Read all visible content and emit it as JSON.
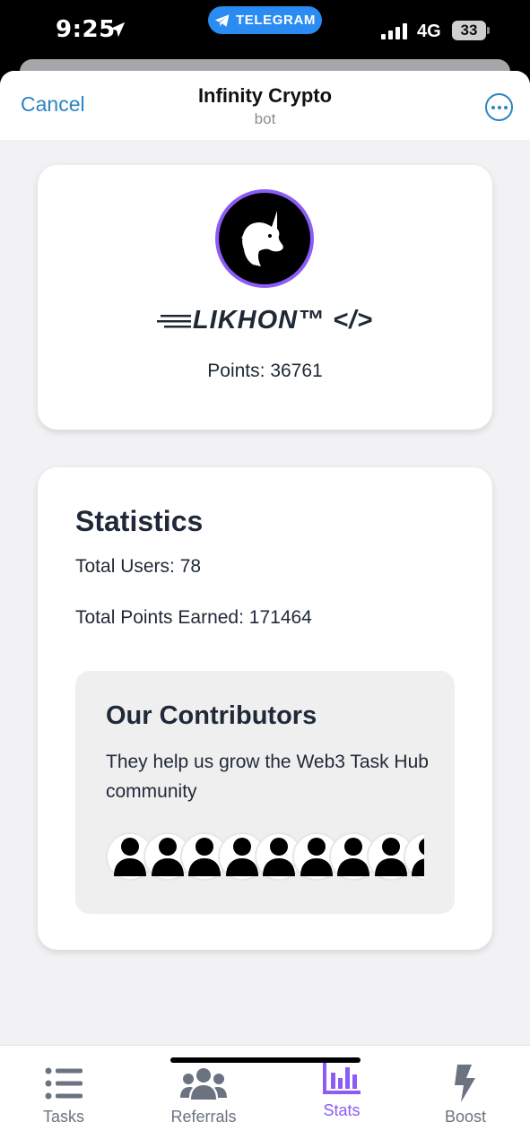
{
  "status_bar": {
    "time": "9:25",
    "app_pill": "TELEGRAM",
    "network": "4G",
    "battery": "33"
  },
  "header": {
    "cancel_label": "Cancel",
    "title": "Infinity Crypto",
    "subtitle": "bot"
  },
  "profile": {
    "username": "LIKHON™ </>",
    "points": "Points: 36761",
    "avatar_icon": "unicorn-icon",
    "avatar_ring_color": "#8b5cf6"
  },
  "stats": {
    "title": "Statistics",
    "total_users": "Total Users: 78",
    "total_points": "Total Points Earned: 171464"
  },
  "contributors": {
    "title": "Our Contributors",
    "text": "They help us grow the Web3 Task Hub community",
    "avatar_icon": "person-icon"
  },
  "tabs": [
    {
      "label": "Tasks",
      "icon": "list-icon",
      "active": false
    },
    {
      "label": "Referrals",
      "icon": "users-icon",
      "active": false
    },
    {
      "label": "Stats",
      "icon": "bar-chart-icon",
      "active": true
    },
    {
      "label": "Boost",
      "icon": "lightning-icon",
      "active": false
    }
  ],
  "colors": {
    "accent_blue": "#2a85c1",
    "active_tab": "#8b5cf6",
    "inactive_tab": "#6b7280",
    "telegram_blue": "#2a8bf2"
  }
}
